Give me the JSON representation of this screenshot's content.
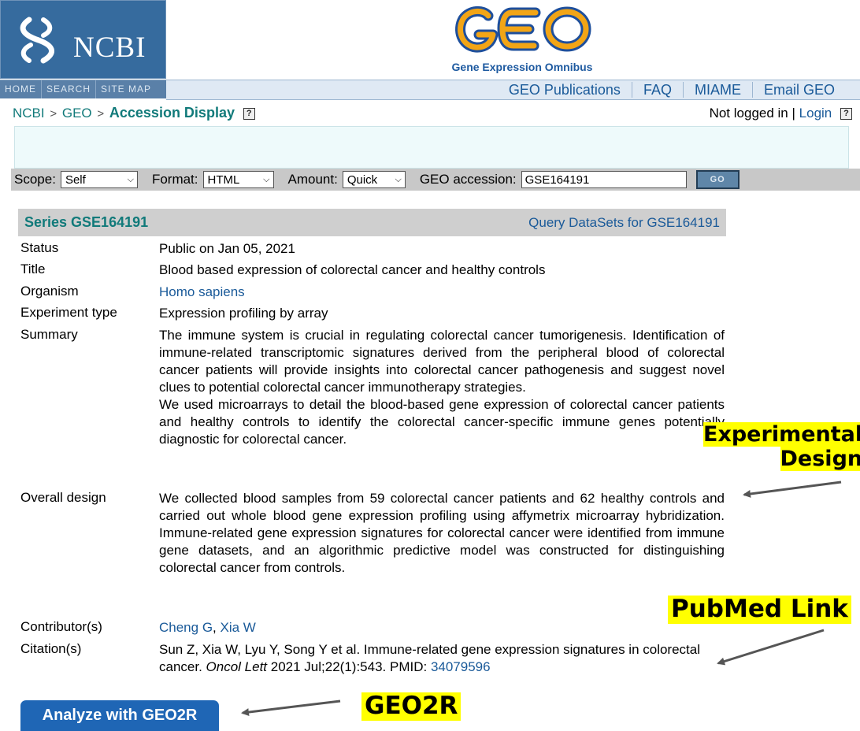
{
  "header": {
    "ncbi_logo_text": "NCBI",
    "geo_logo_text": "GEO",
    "geo_subtitle": "Gene Expression Omnibus",
    "ncbi_nav": [
      "HOME",
      "SEARCH",
      "SITE MAP"
    ],
    "geo_nav": [
      "GEO Publications",
      "FAQ",
      "MIAME",
      "Email GEO"
    ]
  },
  "breadcrumb": {
    "items": [
      "NCBI",
      "GEO"
    ],
    "separator": ">",
    "current": "Accession Display",
    "help_icon": "?"
  },
  "session": {
    "status": "Not logged in",
    "separator": "|",
    "login_label": "Login",
    "help_icon": "?"
  },
  "query_bar": {
    "scope_label": "Scope:",
    "scope_value": "Self",
    "format_label": "Format:",
    "format_value": "HTML",
    "amount_label": "Amount:",
    "amount_value": "Quick",
    "accession_label": "GEO accession:",
    "accession_value": "GSE164191",
    "go_label": "GO"
  },
  "series": {
    "id": "Series GSE164191",
    "query_link": "Query DataSets for GSE164191",
    "status_label": "Status",
    "status_value": "Public on Jan 05, 2021",
    "title_label": "Title",
    "title_value": "Blood based expression of colorectal cancer and healthy controls",
    "organism_label": "Organism",
    "organism_value": "Homo sapiens",
    "experiment_type_label": "Experiment type",
    "experiment_type_value": "Expression profiling by array",
    "summary_label": "Summary",
    "summary_p1": "The immune system is crucial in regulating colorectal cancer tumorigenesis. Identification of immune-related transcriptomic signatures derived from the peripheral blood of colorectal cancer patients will provide insights into colorectal cancer pathogenesis and suggest novel clues to potential colorectal cancer immunotherapy strategies.",
    "summary_p2": "We used microarrays to detail the blood-based gene expression of colorectal cancer patients and healthy controls to identify the colorectal cancer-specific immune genes potentially diagnostic for colorectal cancer.",
    "overall_design_label": "Overall design",
    "overall_design_value": "We collected blood samples from 59 colorectal cancer patients and 62 healthy controls and carried out whole blood gene expression profiling using affymetrix microarray hybridization. Immune-related gene expression signatures for colorectal cancer were identified from immune gene datasets, and an algorithmic predictive model was constructed for distinguishing colorectal cancer from controls.",
    "contributors_label": "Contributor(s)",
    "contributor_1": "Cheng G",
    "contributor_sep": ", ",
    "contributor_2": "Xia W",
    "citation_label": "Citation(s)",
    "citation_text": "Sun Z, Xia W, Lyu Y, Song Y et al. Immune-related gene expression signatures in colorectal cancer. ",
    "citation_journal": "Oncol Lett",
    "citation_details": " 2021 Jul;22(1):543. PMID: ",
    "citation_pmid": "34079596"
  },
  "geo2r_button": "Analyze with GEO2R",
  "annotations": {
    "design_line1": "Experimental",
    "design_line2": "Design",
    "pubmed": "PubMed Link",
    "geo2r": "GEO2R",
    "highlight_color": "#ffff00"
  }
}
